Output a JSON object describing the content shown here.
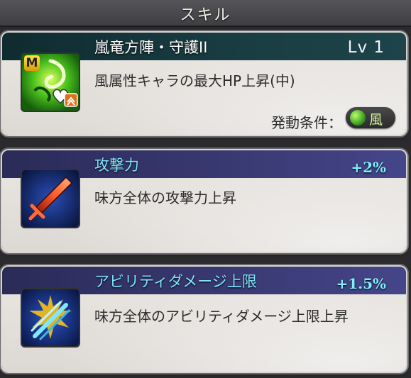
{
  "header": {
    "title": "スキル"
  },
  "skills": [
    {
      "name": "嵐竜方陣・守護II",
      "level": "Lv 1",
      "description": "風属性キャラの最大HP上昇(中)",
      "condition_label": "発動条件：",
      "element_label": "風",
      "icon_badge": "M",
      "icon": "wind-hp-skill-icon"
    },
    {
      "name": "攻撃力",
      "bonus": "+2%",
      "description": "味方全体の攻撃力上昇",
      "icon": "attack-up-icon"
    },
    {
      "name": "アビリティダメージ上限",
      "bonus": "+1.5%",
      "description": "味方全体のアビリティダメージ上限上昇",
      "icon": "ability-damage-cap-icon"
    }
  ],
  "colors": {
    "card_title_dark": "#183c42",
    "card_title_purple": "#3a3a74",
    "highlight_cyan": "#7fe3ff",
    "wind_green": "#2c8f1b"
  }
}
